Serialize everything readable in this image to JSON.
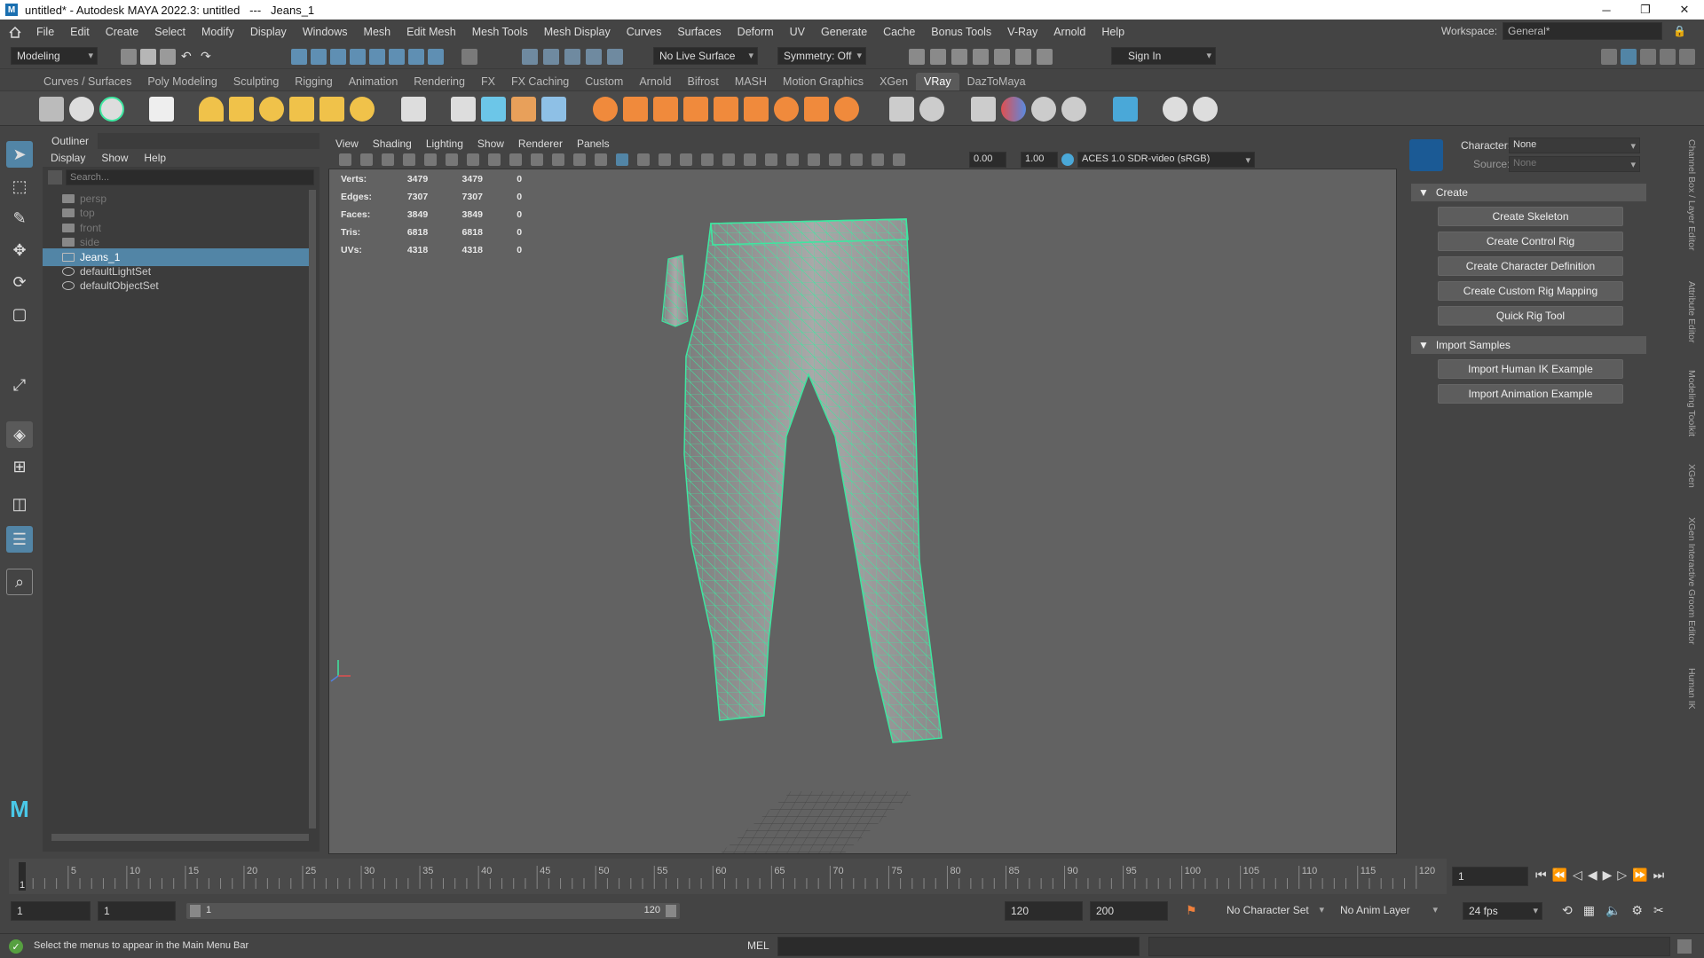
{
  "title_bar": {
    "title": "untitled* - Autodesk MAYA 2022.3: untitled   ---   Jeans_1",
    "app_icon_glyph": "M",
    "minimize": "─",
    "restore": "❐",
    "close": "✕"
  },
  "menubar": {
    "items": [
      "File",
      "Edit",
      "Create",
      "Select",
      "Modify",
      "Display",
      "Windows",
      "Mesh",
      "Edit Mesh",
      "Mesh Tools",
      "Mesh Display",
      "Curves",
      "Surfaces",
      "Deform",
      "UV",
      "Generate",
      "Cache",
      "Bonus Tools",
      "V-Ray",
      "Arnold",
      "Help"
    ],
    "workspace_label": "Workspace:",
    "workspace_value": "General*"
  },
  "statusline": {
    "menu_set": "Modeling",
    "live_surface": "No Live Surface",
    "symmetry": "Symmetry: Off",
    "sign_in": "Sign In"
  },
  "shelf": {
    "tabs": [
      "Curves / Surfaces",
      "Poly Modeling",
      "Sculpting",
      "Rigging",
      "Animation",
      "Rendering",
      "FX",
      "FX Caching",
      "Custom",
      "Arnold",
      "Bifrost",
      "MASH",
      "Motion Graphics",
      "XGen",
      "VRay",
      "DazToMaya"
    ],
    "active_tab": "VRay"
  },
  "outliner": {
    "title": "Outliner",
    "menu": [
      "Display",
      "Show",
      "Help"
    ],
    "search_placeholder": "Search...",
    "items": [
      {
        "label": "persp",
        "icon": "camera-icon",
        "dim": true
      },
      {
        "label": "top",
        "icon": "camera-icon",
        "dim": true
      },
      {
        "label": "front",
        "icon": "camera-icon",
        "dim": true
      },
      {
        "label": "side",
        "icon": "camera-icon",
        "dim": true
      },
      {
        "label": "Jeans_1",
        "icon": "mesh-icon",
        "selected": true
      },
      {
        "label": "defaultLightSet",
        "icon": "set-icon"
      },
      {
        "label": "defaultObjectSet",
        "icon": "set-icon"
      }
    ]
  },
  "viewport": {
    "menu": [
      "View",
      "Shading",
      "Lighting",
      "Show",
      "Renderer",
      "Panels"
    ],
    "exposure": "0.00",
    "gamma": "1.00",
    "color_space": "ACES 1.0 SDR-video (sRGB)",
    "hud": [
      {
        "label": "Verts:",
        "a": "3479",
        "b": "3479",
        "c": "0"
      },
      {
        "label": "Edges:",
        "a": "7307",
        "b": "7307",
        "c": "0"
      },
      {
        "label": "Faces:",
        "a": "3849",
        "b": "3849",
        "c": "0"
      },
      {
        "label": "Tris:",
        "a": "6818",
        "b": "6818",
        "c": "0"
      },
      {
        "label": "UVs:",
        "a": "4318",
        "b": "4318",
        "c": "0"
      }
    ],
    "wire_color": "#3ee6a0"
  },
  "human_ik": {
    "character_label": "Character:",
    "character_value": "None",
    "source_label": "Source:",
    "source_value": "None",
    "create_section": "Create",
    "create_buttons": [
      "Create Skeleton",
      "Create Control Rig",
      "Create Character Definition",
      "Create Custom Rig Mapping",
      "Quick Rig Tool"
    ],
    "import_section": "Import Samples",
    "import_buttons": [
      "Import Human IK Example",
      "Import Animation Example"
    ]
  },
  "side_tabs": [
    "Channel Box / Layer Editor",
    "Attribute Editor",
    "Modeling Toolkit",
    "XGen",
    "XGen Interactive Groom Editor",
    "Human IK"
  ],
  "timeline": {
    "ticks": [
      "5",
      "10",
      "15",
      "20",
      "25",
      "30",
      "35",
      "40",
      "45",
      "50",
      "55",
      "60",
      "65",
      "70",
      "75",
      "80",
      "85",
      "90",
      "95",
      "100",
      "105",
      "110",
      "115",
      "120"
    ],
    "start_marker": "1",
    "current_frame": "1"
  },
  "range": {
    "start": "1",
    "playback_start": "1",
    "range_left": "1",
    "range_right": "120",
    "playback_end": "120",
    "end": "200",
    "character_set": "No Character Set",
    "anim_layer": "No Anim Layer",
    "fps": "24 fps"
  },
  "help_line": {
    "message": "Select the menus to appear in the Main Menu Bar",
    "mel_label": "MEL"
  }
}
